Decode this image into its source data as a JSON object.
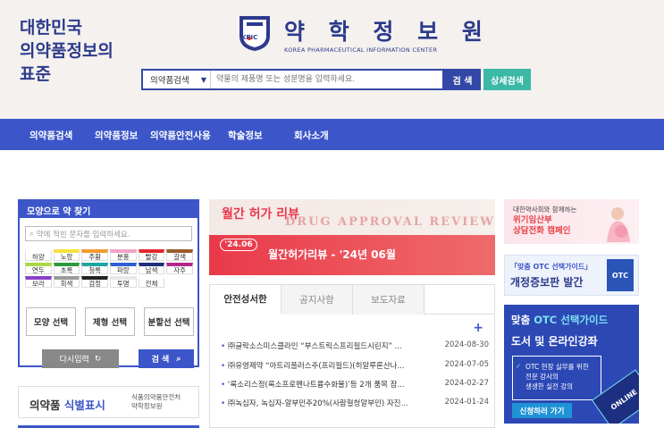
{
  "header": {
    "slogan_lines": [
      "대한민국",
      "의약품정보의",
      "표준"
    ],
    "logo_title": "약 학 정 보 원",
    "logo_sub": "KOREA PHARMACEUTICAL INFORMATION CENTER",
    "logo_badge": "KPIC",
    "search_select": "의약품검색",
    "search_placeholder": "약물의 제품명 또는 성분명을 입력하세요.",
    "search_btn": "검 색",
    "detail_btn": "상세검색"
  },
  "gnb": [
    "의약품검색",
    "의약품정보",
    "의약품안전사용",
    "학술정보",
    "회사소개"
  ],
  "shape_search": {
    "title": "모양으로 약 찾기",
    "input_placeholder": "약에 적힌 문자를 입력하세요.",
    "colors": [
      {
        "label": "하양",
        "color": "#ffffff"
      },
      {
        "label": "노랑",
        "color": "#f5e23b"
      },
      {
        "label": "주황",
        "color": "#f39a2b"
      },
      {
        "label": "분홍",
        "color": "#f4a2c8"
      },
      {
        "label": "빨강",
        "color": "#e6262e"
      },
      {
        "label": "갈색",
        "color": "#9c5a2b"
      },
      {
        "label": "연두",
        "color": "#a8d84a"
      },
      {
        "label": "초록",
        "color": "#2b9a3a"
      },
      {
        "label": "청록",
        "color": "#1ea6a0"
      },
      {
        "label": "파랑",
        "color": "#2e5fd6"
      },
      {
        "label": "남색",
        "color": "#1f2f7a"
      },
      {
        "label": "자주",
        "color": "#b3268c"
      },
      {
        "label": "보라",
        "color": "#8a3fc7"
      },
      {
        "label": "회색",
        "color": "#9a9a9a"
      },
      {
        "label": "검정",
        "color": "#222222"
      },
      {
        "label": "투명",
        "color": "#e8e8e8"
      },
      {
        "label": "전체",
        "color": "#ffffff"
      }
    ],
    "buttons": [
      "모양 선택",
      "제형 선택",
      "분할선 선택"
    ],
    "reset": "다시입력",
    "go": "검 색"
  },
  "ident": {
    "main_a": "의약품",
    "main_b": "식별표시",
    "sub_1": "식품의약품안전처",
    "sub_2": "약학정보원"
  },
  "review": {
    "title": "월간 허가 리뷰",
    "ghost": "DRUG APPROVAL REVIEW",
    "badge": "'24.06",
    "issue": "월간허가리뷰 - '24년 06월"
  },
  "news": {
    "tabs": [
      "안전성서한",
      "공지사항",
      "보도자료"
    ],
    "more": "+",
    "items": [
      {
        "text": "㈜글락소스미스클라인 “부스트릭스프리필드시린지” ...",
        "date": "2024-08-30"
      },
      {
        "text": "㈜유영제약 “아트리플러스주(프리필드)(히알루론산나...",
        "date": "2024-07-05"
      },
      {
        "text": "‘록소리스정(록소프로펜나트륨수화물)’등 2개 품목 잠...",
        "date": "2024-02-27"
      },
      {
        "text": "㈜녹십자, 녹십자-알부민주20%(사람혈청알부민) 자진...",
        "date": "2024-01-24"
      }
    ]
  },
  "banners": {
    "b1_a": "대한약사회와 함께하는",
    "b1_b1": "위기임산부",
    "b1_b2": "상담전화 캠페인",
    "b2_a": "「맞춤 OTC 선택가이드」",
    "b2_b": "개정증보판 발간",
    "b2_book": "OTC",
    "b3_a1": "맞춤",
    "b3_a2": "OTC 선택가이드",
    "b3_b": "도서 및 온라인강좌",
    "b3_card": [
      "OTC 현장 실무를 위한",
      "전문 강사의",
      "생생한 실전 강의"
    ],
    "b3_apply": "신청하러 가기",
    "b3_online": "ONLINE"
  }
}
